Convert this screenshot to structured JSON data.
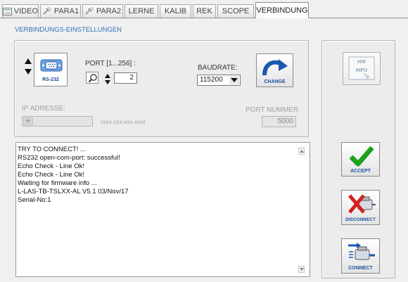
{
  "tabs": [
    {
      "label": "VIDEO",
      "icon": "video-icon"
    },
    {
      "label": "PARA1",
      "icon": "tools-icon"
    },
    {
      "label": "PARA2",
      "icon": "tools-icon"
    },
    {
      "label": "LERNE"
    },
    {
      "label": "KALIB"
    },
    {
      "label": "REK"
    },
    {
      "label": "SCOPE"
    },
    {
      "label": "VERBINDUNG",
      "active": true
    }
  ],
  "section_title": "VERBINDUNGS-EINSTELLUNGEN",
  "connection": {
    "interface_label": "RS-232",
    "port_label": "PORT [1...256] :",
    "port_value": "2",
    "baudrate_label": "BAUDRATE:",
    "baudrate_value": "115200",
    "change_label": "CHANGE",
    "ip_label": "IP ADRESSE:",
    "ip_placeholder": "(xxx.xxx.xxx.xxx)",
    "port_number_label": "PORT NUMMER",
    "port_number_value": "5000"
  },
  "log": {
    "lines": [
      "TRY TO CONNECT! ...",
      "RS232 open-com-port: successful!",
      "Echo Check - Line Ok!",
      "Echo Check - Line Ok!",
      "Waiting for firmware info ...",
      "L-LAS-TB-TSLXX-AL V5.1   03/Nov/17",
      "Serial-No:1"
    ]
  },
  "buttons": {
    "hw_info_line1": "HW",
    "hw_info_line2": "INFO",
    "accept": "ACCEPT",
    "disconnect": "DISCONNECT",
    "connect": "CONNECT"
  },
  "colors": {
    "accent_blue": "#2f6fb8",
    "accept_green": "#1aa31a",
    "disconnect_red": "#d42020"
  }
}
